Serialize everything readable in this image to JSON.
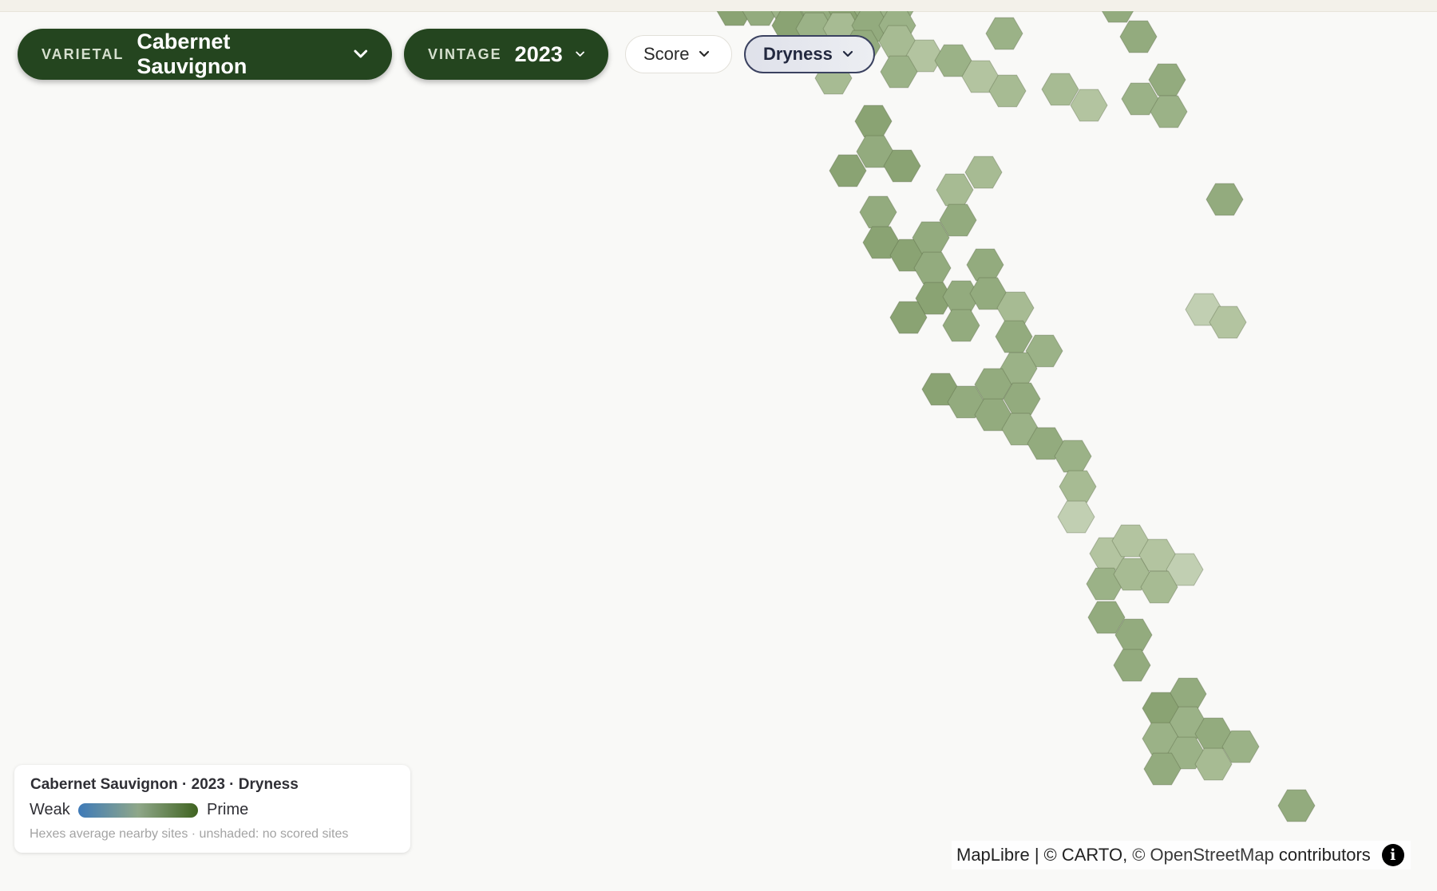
{
  "controls": {
    "varietal": {
      "label": "VARIETAL",
      "value": "Cabernet Sauvignon"
    },
    "vintage": {
      "label": "VINTAGE",
      "value": "2023"
    },
    "metrics": [
      {
        "label": "Score",
        "selected": false
      },
      {
        "label": "Dryness",
        "selected": true
      }
    ]
  },
  "legend": {
    "title": "Cabernet Sauvignon · 2023 · Dryness",
    "low_label": "Weak",
    "high_label": "Prime",
    "note": "Hexes average nearby sites · unshaded: no scored sites",
    "ramp_colors": [
      "#3e7ab8",
      "#8fa789",
      "#3f6320"
    ]
  },
  "attribution": {
    "parts": [
      "MapLibre |",
      "© CARTO,",
      "© OpenStreetMap",
      "contributors"
    ],
    "info_icon": "info-icon"
  },
  "colors": {
    "background": "#f9f9f7",
    "control_dark": "#24451f",
    "hex_mid": "#8fa779",
    "hex_light": "#b3c4a0"
  }
}
